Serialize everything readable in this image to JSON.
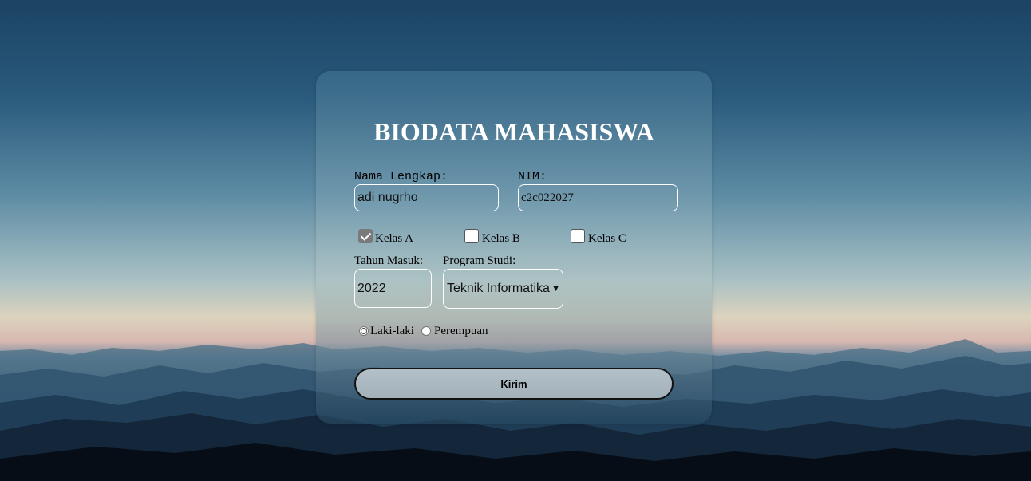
{
  "form": {
    "title": "BIODATA MAHASISWA",
    "nama_label": "Nama Lengkap:",
    "nama_value": "adi nugrho",
    "nim_label": "NIM:",
    "nim_value": "c2c022027",
    "kelas": [
      {
        "label": "Kelas A",
        "checked": true
      },
      {
        "label": "Kelas B",
        "checked": false
      },
      {
        "label": "Kelas C",
        "checked": false
      }
    ],
    "tahun_label": "Tahun Masuk:",
    "tahun_value": "2022",
    "prodi_label": "Program Studi:",
    "prodi_selected": "Teknik Informatika",
    "gender": [
      {
        "label": "Laki-laki",
        "selected": true
      },
      {
        "label": "Perempuan",
        "selected": false
      }
    ],
    "submit_label": "Kirim"
  },
  "icons": {
    "select_chevron": "chevron-down-icon"
  }
}
